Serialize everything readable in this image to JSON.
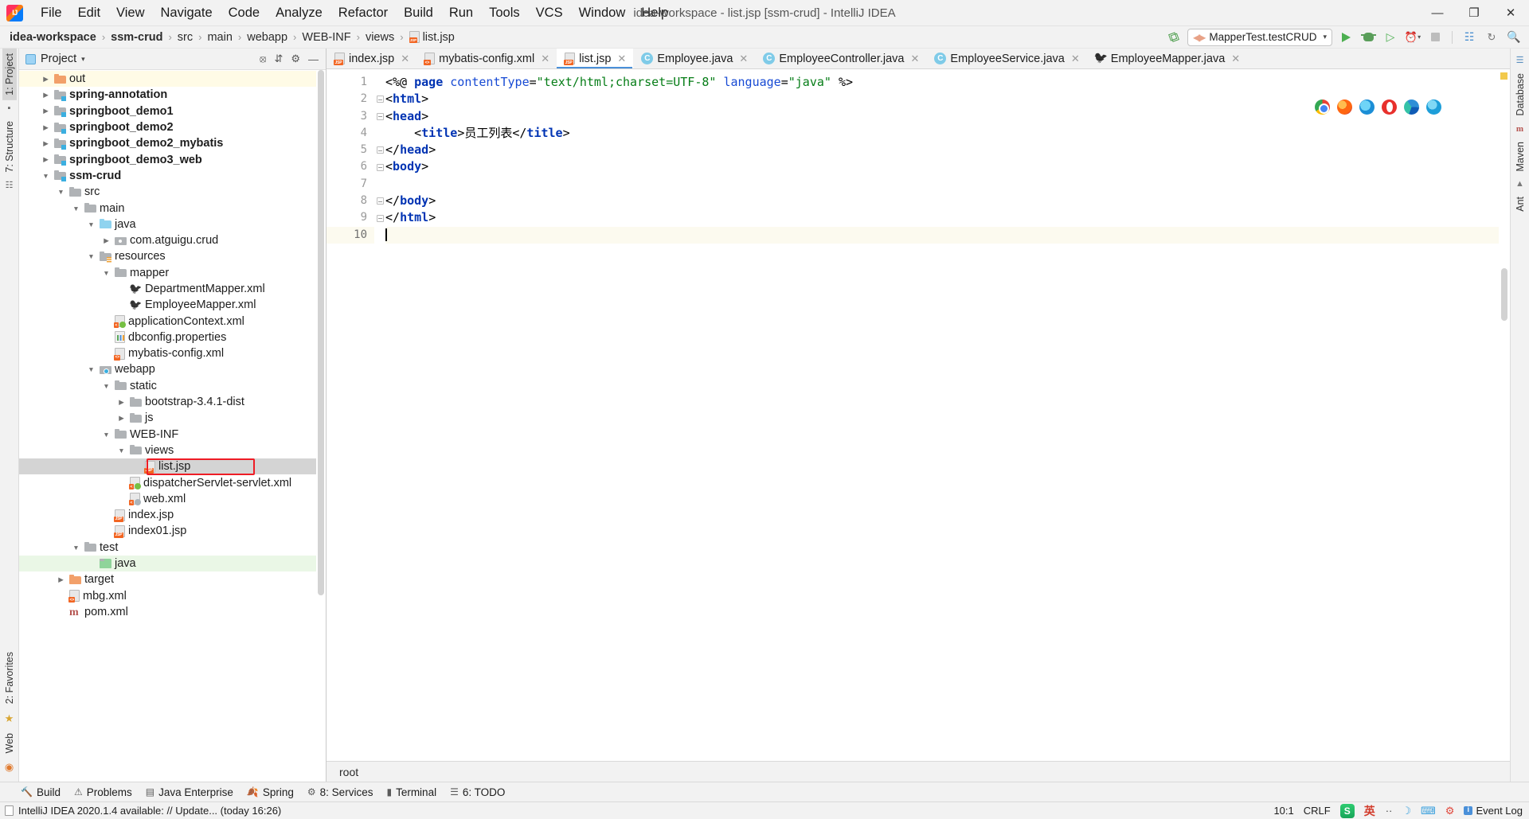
{
  "window": {
    "title": "idea-workspace - list.jsp [ssm-crud] - IntelliJ IDEA",
    "minimize": "—",
    "maximize": "❐",
    "close": "✕"
  },
  "menubar": {
    "items": [
      "File",
      "Edit",
      "View",
      "Navigate",
      "Code",
      "Analyze",
      "Refactor",
      "Build",
      "Run",
      "Tools",
      "VCS",
      "Window",
      "Help"
    ]
  },
  "breadcrumb": {
    "items": [
      {
        "label": "idea-workspace",
        "bold": true
      },
      {
        "label": "ssm-crud",
        "bold": true
      },
      {
        "label": "src",
        "bold": false
      },
      {
        "label": "main",
        "bold": false
      },
      {
        "label": "webapp",
        "bold": false
      },
      {
        "label": "WEB-INF",
        "bold": false
      },
      {
        "label": "views",
        "bold": false
      },
      {
        "label": "list.jsp",
        "bold": false,
        "icon": "jsp-file-icon"
      }
    ],
    "separator": "›"
  },
  "toolbar": {
    "run_config": "MapperTest.testCRUD",
    "run_config_caret": "▾",
    "hammer": "build-icon",
    "run": "run-icon",
    "debug": "debug-icon",
    "run_coverage": "run-with-coverage-icon",
    "profiler": "profiler-icon",
    "profiler_caret": "▾",
    "stop": "stop-icon",
    "layout": "layout-icon",
    "updates": "updates-icon",
    "search": "🔍"
  },
  "left_strip": {
    "project_tab": "1: Project",
    "structure_tab": "7: Structure",
    "favorites_tab": "2: Favorites",
    "web_tab": "Web"
  },
  "right_strip": {
    "database_tab": "Database",
    "maven_tab": "Maven",
    "ant_tab": "Ant"
  },
  "project_panel": {
    "title": "Project",
    "caret": "▾",
    "actions": [
      "locate-icon",
      "collapse-all-icon",
      "settings-icon",
      "hide-icon"
    ],
    "tree": [
      {
        "depth": 1,
        "label": "out",
        "arrow": "r",
        "icon": "folder-orange",
        "bold": false,
        "row": "yellow"
      },
      {
        "depth": 1,
        "label": "spring-annotation",
        "arrow": "r",
        "icon": "module",
        "bold": true
      },
      {
        "depth": 1,
        "label": "springboot_demo1",
        "arrow": "r",
        "icon": "module",
        "bold": true
      },
      {
        "depth": 1,
        "label": "springboot_demo2",
        "arrow": "r",
        "icon": "module",
        "bold": true
      },
      {
        "depth": 1,
        "label": "springboot_demo2_mybatis",
        "arrow": "r",
        "icon": "module",
        "bold": true
      },
      {
        "depth": 1,
        "label": "springboot_demo3_web",
        "arrow": "r",
        "icon": "module",
        "bold": true
      },
      {
        "depth": 1,
        "label": "ssm-crud",
        "arrow": "d",
        "icon": "module",
        "bold": true
      },
      {
        "depth": 2,
        "label": "src",
        "arrow": "d",
        "icon": "folder",
        "bold": false
      },
      {
        "depth": 3,
        "label": "main",
        "arrow": "d",
        "icon": "folder",
        "bold": false
      },
      {
        "depth": 4,
        "label": "java",
        "arrow": "d",
        "icon": "folder-blue",
        "bold": false
      },
      {
        "depth": 5,
        "label": "com.atguigu.crud",
        "arrow": "r",
        "icon": "package",
        "bold": false
      },
      {
        "depth": 4,
        "label": "resources",
        "arrow": "d",
        "icon": "resources",
        "bold": false
      },
      {
        "depth": 5,
        "label": "mapper",
        "arrow": "d",
        "icon": "folder",
        "bold": false
      },
      {
        "depth": 6,
        "label": "DepartmentMapper.xml",
        "arrow": "",
        "icon": "mybatis",
        "bold": false
      },
      {
        "depth": 6,
        "label": "EmployeeMapper.xml",
        "arrow": "",
        "icon": "mybatis",
        "bold": false
      },
      {
        "depth": 5,
        "label": "applicationContext.xml",
        "arrow": "",
        "icon": "spring-xml",
        "bold": false
      },
      {
        "depth": 5,
        "label": "dbconfig.properties",
        "arrow": "",
        "icon": "properties",
        "bold": false
      },
      {
        "depth": 5,
        "label": "mybatis-config.xml",
        "arrow": "",
        "icon": "xml",
        "bold": false
      },
      {
        "depth": 4,
        "label": "webapp",
        "arrow": "d",
        "icon": "webapp",
        "bold": false
      },
      {
        "depth": 5,
        "label": "static",
        "arrow": "d",
        "icon": "folder",
        "bold": false
      },
      {
        "depth": 6,
        "label": "bootstrap-3.4.1-dist",
        "arrow": "r",
        "icon": "folder",
        "bold": false
      },
      {
        "depth": 6,
        "label": "js",
        "arrow": "r",
        "icon": "folder",
        "bold": false
      },
      {
        "depth": 5,
        "label": "WEB-INF",
        "arrow": "d",
        "icon": "folder",
        "bold": false
      },
      {
        "depth": 6,
        "label": "views",
        "arrow": "d",
        "icon": "folder",
        "bold": false
      },
      {
        "depth": 7,
        "label": "list.jsp",
        "arrow": "",
        "icon": "jsp",
        "bold": false,
        "row": "selected",
        "highlight": true
      },
      {
        "depth": 6,
        "label": "dispatcherServlet-servlet.xml",
        "arrow": "",
        "icon": "spring-xml",
        "bold": false
      },
      {
        "depth": 6,
        "label": "web.xml",
        "arrow": "",
        "icon": "web-xml",
        "bold": false
      },
      {
        "depth": 5,
        "label": "index.jsp",
        "arrow": "",
        "icon": "jsp",
        "bold": false
      },
      {
        "depth": 5,
        "label": "index01.jsp",
        "arrow": "",
        "icon": "jsp",
        "bold": false
      },
      {
        "depth": 3,
        "label": "test",
        "arrow": "d",
        "icon": "folder",
        "bold": false
      },
      {
        "depth": 4,
        "label": "java",
        "arrow": "",
        "icon": "folder-green",
        "bold": false,
        "row": "green"
      },
      {
        "depth": 2,
        "label": "target",
        "arrow": "r",
        "icon": "folder-orange",
        "bold": false
      },
      {
        "depth": 2,
        "label": "mbg.xml",
        "arrow": "",
        "icon": "xml",
        "bold": false
      },
      {
        "depth": 2,
        "label": "pom.xml",
        "arrow": "",
        "icon": "maven",
        "bold": false
      }
    ]
  },
  "editor_tabs": [
    {
      "label": "index.jsp",
      "icon": "jsp",
      "active": false,
      "close": "✕"
    },
    {
      "label": "mybatis-config.xml",
      "icon": "xml",
      "active": false,
      "close": "✕"
    },
    {
      "label": "list.jsp",
      "icon": "jsp",
      "active": true,
      "close": "✕"
    },
    {
      "label": "Employee.java",
      "icon": "class",
      "active": false,
      "close": "✕"
    },
    {
      "label": "EmployeeController.java",
      "icon": "class",
      "active": false,
      "close": "✕"
    },
    {
      "label": "EmployeeService.java",
      "icon": "class",
      "active": false,
      "close": "✕"
    },
    {
      "label": "EmployeeMapper.java",
      "icon": "mapper",
      "active": false,
      "close": "✕"
    }
  ],
  "editor": {
    "line_numbers": [
      "1",
      "2",
      "3",
      "4",
      "5",
      "6",
      "7",
      "8",
      "9",
      "10"
    ],
    "current_line": 10,
    "caret_column_label": "10:1",
    "lines": [
      {
        "n": 1,
        "html": "<span class='tk-dir'>&lt;%@ </span><span class='tk-tag'>page </span><span class='tk-attr'>contentType</span><span class='tk-dir'>=</span><span class='tk-str'>\"text/html;charset=UTF-8\"</span><span class='tk-dir'> </span><span class='tk-attr'>language</span><span class='tk-dir'>=</span><span class='tk-str'>\"java\"</span><span class='tk-dir'> %&gt;</span>",
        "indent": 0
      },
      {
        "n": 2,
        "html": "<span class='tk-dir'>&lt;</span><span class='tk-tag'>html</span><span class='tk-dir'>&gt;</span>",
        "indent": 0,
        "fold": true
      },
      {
        "n": 3,
        "html": "<span class='tk-dir'>&lt;</span><span class='tk-tag'>head</span><span class='tk-dir'>&gt;</span>",
        "indent": 0,
        "fold": true
      },
      {
        "n": 4,
        "html": "    <span class='tk-dir'>&lt;</span><span class='tk-tag'>title</span><span class='tk-dir'>&gt;</span><span class='tk-text'>员工列表</span><span class='tk-dir'>&lt;/</span><span class='tk-tag'>title</span><span class='tk-dir'>&gt;</span>",
        "indent": 4
      },
      {
        "n": 5,
        "html": "<span class='tk-dir'>&lt;/</span><span class='tk-tag'>head</span><span class='tk-dir'>&gt;</span>",
        "indent": 0,
        "fold": true
      },
      {
        "n": 6,
        "html": "<span class='tk-dir'>&lt;</span><span class='tk-tag'>body</span><span class='tk-dir'>&gt;</span>",
        "indent": 0,
        "fold": true
      },
      {
        "n": 7,
        "html": "",
        "indent": 0
      },
      {
        "n": 8,
        "html": "<span class='tk-dir'>&lt;/</span><span class='tk-tag'>body</span><span class='tk-dir'>&gt;</span>",
        "indent": 0,
        "fold": true
      },
      {
        "n": 9,
        "html": "<span class='tk-dir'>&lt;/</span><span class='tk-tag'>html</span><span class='tk-dir'>&gt;</span>",
        "indent": 0,
        "fold": true
      },
      {
        "n": 10,
        "html": "",
        "indent": 0,
        "caret": true
      }
    ],
    "plain_text": "<%@ page contentType=\"text/html;charset=UTF-8\" language=\"java\" %>\n<html>\n<head>\n    <title>员工列表</title>\n</head>\n<body>\n\n</body>\n</html>\n",
    "browser_icons": [
      "chrome-icon",
      "firefox-icon",
      "edge-legacy-icon",
      "opera-icon",
      "edge-icon",
      "ie-icon"
    ],
    "bottom_breadcrumb": "root"
  },
  "toolwindow_bar": {
    "items": [
      {
        "label": "Build",
        "icon": "build-icon"
      },
      {
        "label": "Problems",
        "icon": "problems-icon"
      },
      {
        "label": "Java Enterprise",
        "icon": "java-enterprise-icon"
      },
      {
        "label": "Spring",
        "icon": "spring-icon"
      },
      {
        "label": "8: Services",
        "icon": "services-icon"
      },
      {
        "label": "Terminal",
        "icon": "terminal-icon"
      },
      {
        "label": "6: TODO",
        "icon": "todo-icon"
      }
    ]
  },
  "statusbar": {
    "message": "IntelliJ IDEA 2020.1.4 available: // Update... (today 16:26)",
    "caret_position": "10:1",
    "line_separator": "CRLF",
    "ime_label": "英",
    "ime_dots": "··",
    "ime_moon": "☽",
    "event_log": "Event Log",
    "notification_count": "1"
  }
}
